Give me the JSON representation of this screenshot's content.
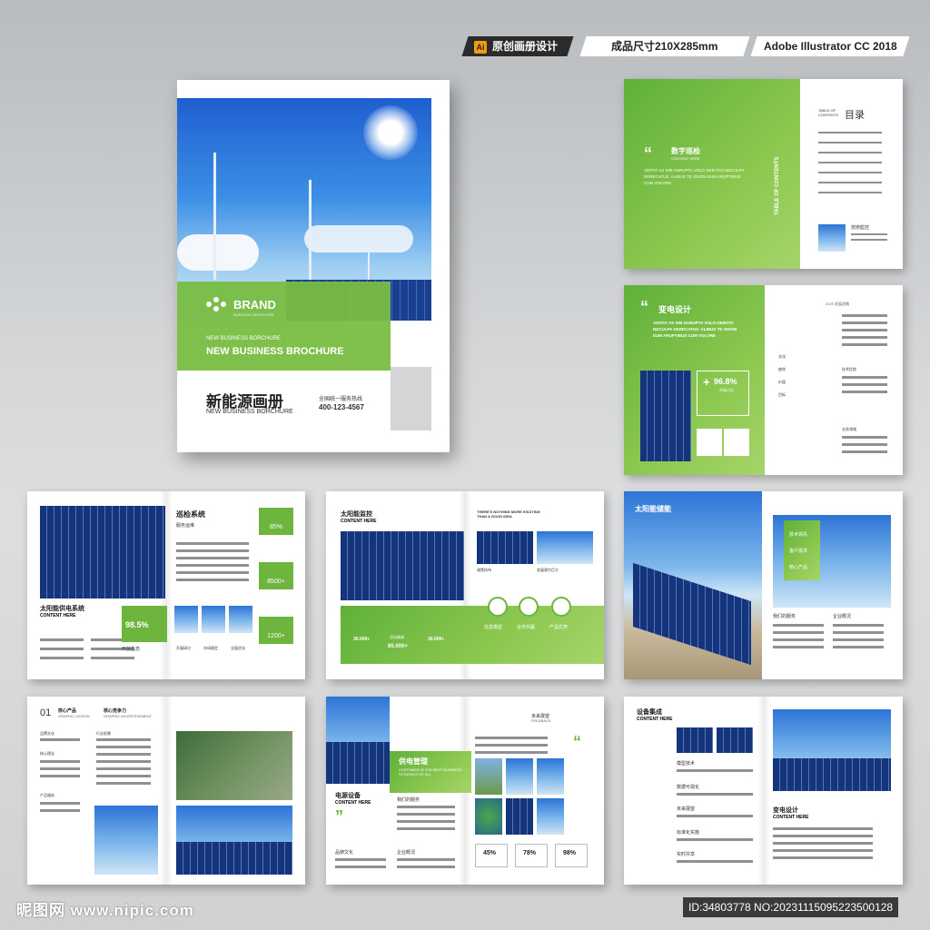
{
  "header": {
    "tag_ai": "Ai",
    "tag_original": "原创画册设计",
    "tag_size": "成品尺寸210X285mm",
    "tag_software": "Adobe Illustrator CC 2018"
  },
  "cover": {
    "brand": "BRAND",
    "brand_sub": "BUSINESS BROCHURE",
    "line1": "NEW BUSINESS BORCHURE",
    "line2": "NEW BUSINESS BROCHURE",
    "title": "新能源画册",
    "subtitle": "NEW BUSINESS BORCHURE",
    "hotline_label": "全国统一服务热线",
    "hotline": "400-123-4567"
  },
  "spread_toc": {
    "heading": "数字巡检",
    "content_here": "CONTENT HERE",
    "body": "ADITAT AS SIM HARUPTA VOLO DEB ITIO NECULPA DERECATUS. ALIBUS TE ODION EUM ARUPTIBUS CUM VOLORE",
    "toc_en": "TABLE OF CONTENTS",
    "toc_cn": "目录",
    "vertical": "TABLE OF CONTENTS",
    "person_label": "技術監控"
  },
  "spread_substation": {
    "heading": "变电设计",
    "body": "ADITAT AS SIM HARUPTA VOLO DEBITIO NECULPA DERECATUS. ALIBUS TE ODION EUM ARUPTIBUS CUM VOLORE",
    "percent": "96.8%",
    "percent_sub": "市场占比",
    "right_title": "2025 发展战略",
    "items": [
      "文化",
      "使命",
      "价值",
      "目标"
    ],
    "right_label1": "技术优势",
    "right_label2": "业务领域"
  },
  "spread_inspection": {
    "heading": "巡检系统",
    "sub": "服务运维",
    "left_title": "太阳能供电系统",
    "content_here": "CONTENT HERE",
    "percent": "98.5%",
    "eco": "开放生态",
    "stats": [
      "85%",
      "8500+",
      "1200+"
    ],
    "thumbs": [
      "开展研讨",
      "市场稳定",
      "全面优化"
    ]
  },
  "spread_monitor": {
    "heading": "太阳能监控",
    "content_here": "CONTENT HERE",
    "tagline": "THERE'S NOTHING MORE EXCITING THAN A GOOD IDEA",
    "img_labels": [
      "政策扶持",
      "发展潜力巨大"
    ],
    "nums": [
      "30.000+",
      "85.000+",
      "30.000+"
    ],
    "num_label": "活动邀请",
    "icons": [
      "信息模型",
      "合作共赢",
      "产品优势"
    ]
  },
  "spread_storage": {
    "heading": "太阳能储能",
    "menu": [
      "技术领先",
      "客户需求",
      "核心产品"
    ],
    "labels": [
      "我们的服务",
      "企业概况"
    ]
  },
  "spread_core": {
    "num": "01",
    "h1": "核心产品",
    "h1_en": "GRAPHIC DESIGN",
    "h2": "核心竞争力",
    "h2_en": "GRAPHIC ADVERTISEMENT",
    "items": [
      "品牌文化",
      "行业前景",
      "核心理念",
      "产品服务"
    ]
  },
  "spread_supply": {
    "heading": "供电管理",
    "heading_en": "CUSTOMER IS THE BEST BUSINESS STRATEGY OF ALL",
    "left_title": "电源设备",
    "content_here": "CONTENT HERE",
    "services": "我们的服务",
    "brand_culture": "品牌文化",
    "overview": "企业概况",
    "future": "未来展望",
    "feedback": "FEEDBACK",
    "stats": [
      "45%",
      "78%",
      "98%"
    ]
  },
  "spread_integration": {
    "heading": "设备集成",
    "content_here": "CONTENT HERE",
    "items": [
      "模型技术",
      "数据可视化",
      "未来展望",
      "标准化实施",
      "实时共享"
    ],
    "right_title": "变电设计",
    "right_sub": "CONTENT HERE"
  },
  "footer": {
    "watermark": "昵图网 www.nipic.com",
    "id": "ID:34803778 NO:20231115095223500128"
  }
}
